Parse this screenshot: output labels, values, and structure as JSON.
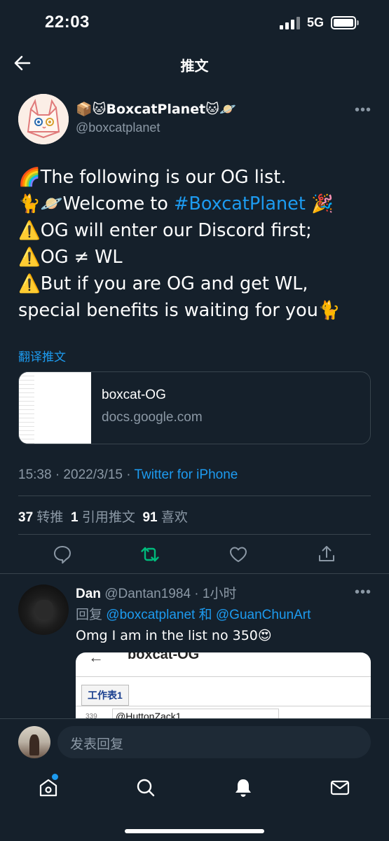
{
  "status_bar": {
    "time": "22:03",
    "network": "5G",
    "battery_level": 1.0
  },
  "header": {
    "title": "推文"
  },
  "tweet": {
    "author": {
      "name": "📦🐱BoxcatPlanet🐱🪐",
      "handle": "@boxcatplanet"
    },
    "lines": [
      {
        "pre": "🌈The following is our OG list.",
        "hashtag": "",
        "post": ""
      },
      {
        "pre": "🐈🪐Welcome to ",
        "hashtag": "#BoxcatPlanet",
        "post": " 🎉"
      },
      {
        "pre": "⚠️OG will enter our Discord first;",
        "hashtag": "",
        "post": ""
      },
      {
        "pre": "⚠️OG ≠ WL",
        "hashtag": "",
        "post": ""
      },
      {
        "pre": "⚠️But if you are OG and get WL,",
        "hashtag": "",
        "post": ""
      },
      {
        "pre": "special benefits is waiting for you🐈",
        "hashtag": "",
        "post": ""
      }
    ],
    "translate_label": "翻译推文",
    "card": {
      "title": "boxcat-OG",
      "domain": "docs.google.com"
    },
    "timestamp": "15:38 · 2022/3/15 · ",
    "source": "Twitter for iPhone",
    "stats": {
      "retweets_count": "37",
      "retweets_label": "转推",
      "quotes_count": "1",
      "quotes_label": "引用推文",
      "likes_count": "91",
      "likes_label": "喜欢"
    }
  },
  "reply": {
    "name": "Dan",
    "handle_time": "@Dantan1984 · 1小时",
    "replying_prefix": "回复 ",
    "mention_1": "@boxcatplanet",
    "joiner": " 和 ",
    "mention_2": "@GuanChunArt",
    "text": "Omg I am in the list no 350😍",
    "image": {
      "doc_title": "boxcat-OG",
      "sheet_tab": "工作表1",
      "row_number": "339",
      "cell_value": "@HuttonZack1"
    }
  },
  "composer": {
    "placeholder": "发表回复"
  },
  "colors": {
    "background": "#15202b",
    "accent": "#1d9bf0",
    "retweet_green": "#00ba7c",
    "muted": "#8b98a5"
  },
  "icons": {
    "actions": [
      "reply-icon",
      "retweet-icon",
      "like-icon",
      "share-icon"
    ],
    "tabs": [
      "home-icon",
      "search-icon",
      "notifications-icon",
      "messages-icon"
    ]
  }
}
